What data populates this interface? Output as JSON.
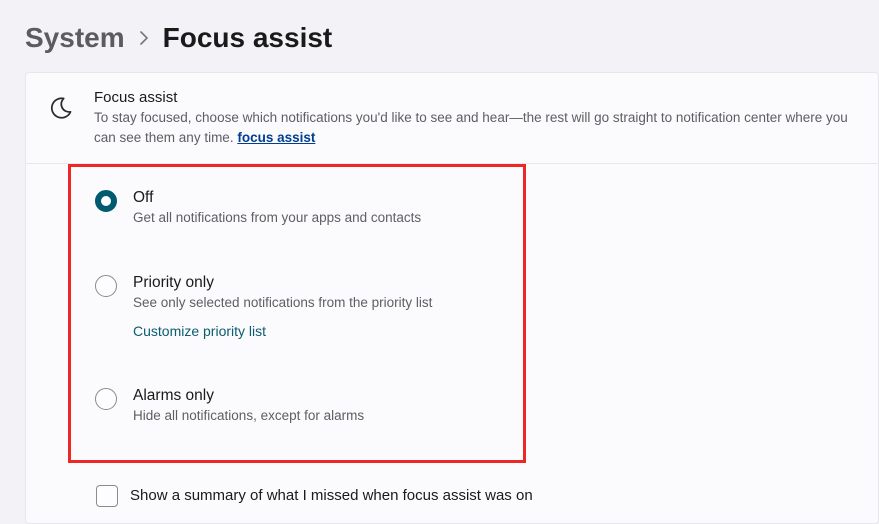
{
  "breadcrumb": {
    "parent": "System",
    "current": "Focus assist"
  },
  "header": {
    "title": "Focus assist",
    "description_pre": "To stay focused, choose which notifications you'd like to see and hear—the rest will go straight to notification center where you can see them any time. ",
    "link_text": "focus assist",
    "icon": "moon-icon"
  },
  "options": [
    {
      "id": "off",
      "label": "Off",
      "sub": "Get all notifications from your apps and contacts",
      "selected": true
    },
    {
      "id": "priority",
      "label": "Priority only",
      "sub": "See only selected notifications from the priority list",
      "selected": false,
      "link": "Customize priority list"
    },
    {
      "id": "alarms",
      "label": "Alarms only",
      "sub": "Hide all notifications, except for alarms",
      "selected": false
    }
  ],
  "summary": {
    "label": "Show a summary of what I missed when focus assist was on",
    "checked": false
  },
  "highlight_color": "#ed2626"
}
